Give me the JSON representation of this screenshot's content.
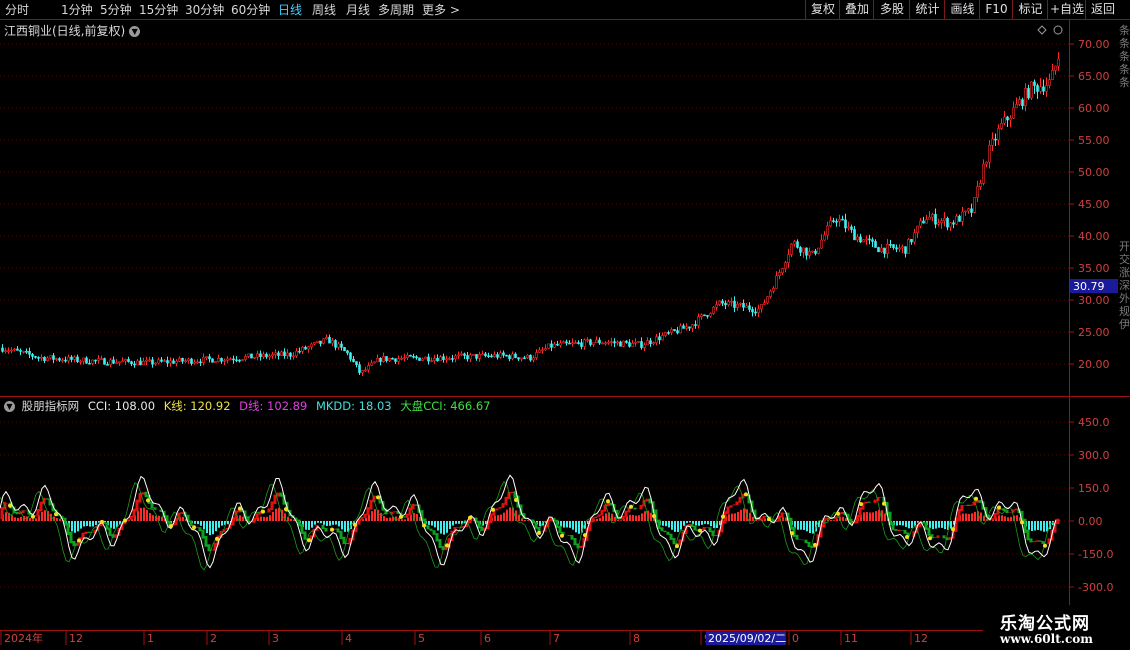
{
  "toolbar": {
    "periods": [
      "分时",
      "1分钟",
      "5分钟",
      "15分钟",
      "30分钟",
      "60分钟",
      "日线",
      "周线",
      "月线",
      "多周期",
      "更多 >"
    ],
    "active_period": "日线",
    "right_buttons": [
      "复权",
      "叠加",
      "多股",
      "统计",
      "画线",
      "F10",
      "标记",
      "+自选",
      "返回"
    ]
  },
  "chart_title": "江西铜业(日线,前复权)",
  "price_axis": {
    "ticks": [
      "70.00",
      "65.00",
      "60.00",
      "55.00",
      "50.00",
      "45.00",
      "40.00",
      "35.00",
      "30.00",
      "25.00",
      "20.00"
    ],
    "current_label": "30.79"
  },
  "indicator": {
    "name": "股朋指标网",
    "cci_label": "CCI: 108.00",
    "k_label": "K线: 120.92",
    "d_label": "D线: 102.89",
    "mkdd_label": "MKDD: 18.03",
    "market_label": "大盘CCI: 466.67",
    "ticks": [
      "450.0",
      "300.0",
      "150.0",
      "0.00",
      "-150.0",
      "-300.0"
    ]
  },
  "date_axis": {
    "labels": [
      "2024年",
      "12",
      "1",
      "2",
      "3",
      "4",
      "5",
      "6",
      "7",
      "8",
      "9",
      "0",
      "11",
      "12"
    ],
    "cursor_date": "2025/09/02/二"
  },
  "watermark": {
    "title": "乐淘公式网",
    "url": "www.60lt.com"
  },
  "side_text": {
    "top": "条条条条条",
    "mid": "开交涨深外规伊"
  },
  "colors": {
    "up": "#ff2a2a",
    "down": "#3ff0f0",
    "grid": "#5a0000",
    "axis": "#a01010",
    "active": "#3fd0ff"
  },
  "chart_data": {
    "type": "candlestick",
    "ylim": [
      17,
      72
    ],
    "indicator_ylim": [
      -380,
      500
    ]
  }
}
